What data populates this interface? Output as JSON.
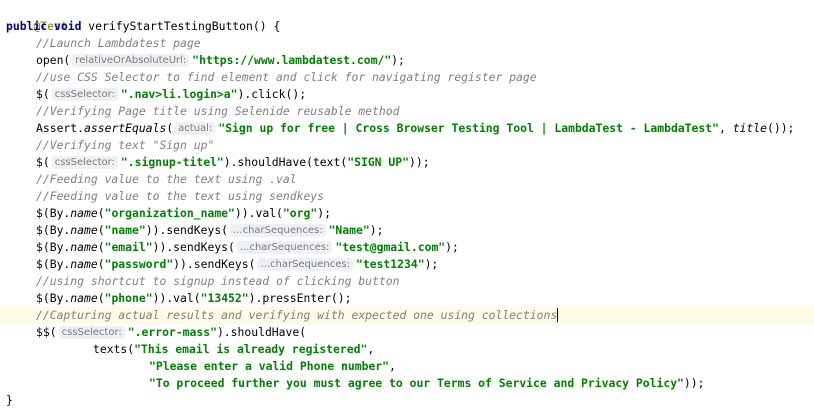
{
  "code": {
    "l1_annotation": "@Test",
    "l2_modifiers": "public void",
    "l2_method": " verifyStartTestingButton() {",
    "l3_comment": "//Launch Lambdatest page",
    "l4_call": "open(",
    "l4_hint": "relativeOrAbsoluteUrl:",
    "l4_str": "\"https://www.lambdatest.com/\"",
    "l4_end": ");",
    "l5_comment": "//use CSS Selector to find element and click for navigating register page",
    "l6_call": "$(",
    "l6_hint": "cssSelector:",
    "l6_str": "\".nav>li.login>a\"",
    "l6_end": ").click();",
    "l7_comment": "//Verifying Page title using Selenide reusable method",
    "l8_assert": "Assert.",
    "l8_method": "assertEquals",
    "l8_paren": "(",
    "l8_hint": "actual:",
    "l8_str": "\"Sign up for free | Cross Browser Testing Tool | LambdaTest - LambdaTest\"",
    "l8_sep": ", ",
    "l8_title": "title",
    "l8_end": "());",
    "l9_comment": "//Verifying text \"Sign up\"",
    "l10_call": "$(",
    "l10_hint": "cssSelector:",
    "l10_str": "\".signup-titel\"",
    "l10_mid": ").shouldHave(text(",
    "l10_str2": "\"SIGN UP\"",
    "l10_end": "));",
    "l11_comment": "//Feeding value to the text using .val",
    "l12_comment": "//Feeding value to the text using sendkeys",
    "l13_pre": "$(By.",
    "l13_name": "name",
    "l13_paren": "(",
    "l13_str": "\"organization_name\"",
    "l13_mid": ")).val(",
    "l13_str2": "\"org\"",
    "l13_end": ");",
    "l14_pre": "$(By.",
    "l14_name": "name",
    "l14_paren": "(",
    "l14_str": "\"name\"",
    "l14_mid": ")).sendKeys(",
    "l14_hint": "...charSequences:",
    "l14_str2": "\"Name\"",
    "l14_end": ");",
    "l15_pre": "$(By.",
    "l15_name": "name",
    "l15_paren": "(",
    "l15_str": "\"email\"",
    "l15_mid": ")).sendKeys(",
    "l15_hint": "...charSequences:",
    "l15_str2": "\"test@gmail.com\"",
    "l15_end": ");",
    "l16_pre": "$(By.",
    "l16_name": "name",
    "l16_paren": "(",
    "l16_str": "\"password\"",
    "l16_mid": ")).sendKeys(",
    "l16_hint": "...charSequences:",
    "l16_str2": "\"test1234\"",
    "l16_end": ");",
    "l17_comment": "//using shortcut to signup instead of clicking button",
    "l18_pre": "$(By.",
    "l18_name": "name",
    "l18_paren": "(",
    "l18_str": "\"phone\"",
    "l18_mid": ")).val(",
    "l18_str2": "\"13452\"",
    "l18_end": ").pressEnter();",
    "l19_comment": "//Capturing actual results and verifying with expected one using collections",
    "l20_call": "$$(",
    "l20_hint": "cssSelector:",
    "l20_str": "\".error-mass\"",
    "l20_end": ").shouldHave(",
    "l21_texts": "texts(",
    "l21_str": "\"This email is already registered\"",
    "l21_end": ",",
    "l22_str": "\"Please enter a valid Phone number\"",
    "l22_end": ",",
    "l23_str": "\"To proceed further you must agree to our Terms of Service and Privacy Policy\"",
    "l23_end": "));",
    "l24_close": "}"
  },
  "colors": {
    "keyword": "#000080",
    "string": "#008000",
    "comment": "#808080",
    "annotation": "#808000",
    "hint_bg": "#edf0f4"
  }
}
